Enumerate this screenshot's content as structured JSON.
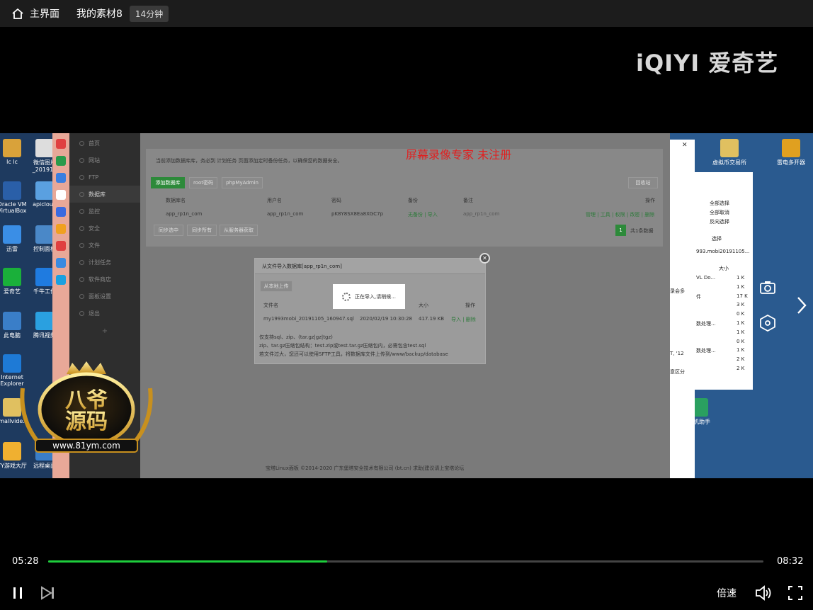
{
  "topbar": {
    "home_label": "主界面",
    "title": "我的素材8",
    "badge": "14分钟"
  },
  "logo": "iQIYI 爱奇艺",
  "watermark": "屏幕录像专家  未注册",
  "desktop_icons": [
    {
      "label": "lc lc",
      "color": "#d9a23a"
    },
    {
      "label": "微信图片_201912",
      "color": "#ddd"
    },
    {
      "label": "Oracle VM VirtualBox",
      "color": "#2a5fa8"
    },
    {
      "label": "apicloud",
      "color": "#5aa0e0"
    },
    {
      "label": "迅雷",
      "color": "#3a8ee6"
    },
    {
      "label": "控制面板",
      "color": "#4a88c8"
    },
    {
      "label": "爱奇艺",
      "color": "#1ab03a"
    },
    {
      "label": "千牛工作",
      "color": "#1f7be0"
    },
    {
      "label": "此电脑",
      "color": "#3a7ec8"
    },
    {
      "label": "腾讯视频",
      "color": "#2aa0e0"
    },
    {
      "label": "Internet Explorer",
      "color": "#1e7ad6"
    },
    {
      "label": "smallvide...",
      "color": "#e0c060"
    },
    {
      "label": "YY游戏大厅",
      "color": "#f0b030"
    },
    {
      "label": "远程桌面",
      "color": "#3a7ec8"
    },
    {
      "label": "虚拟币交易所",
      "color": "#e0c060"
    },
    {
      "label": "雷电多开器",
      "color": "#e0a020"
    },
    {
      "label": "手机助手",
      "color": "#2aa060"
    }
  ],
  "sidebar_items": [
    {
      "label": "首页"
    },
    {
      "label": "网站"
    },
    {
      "label": "FTP"
    },
    {
      "label": "数据库"
    },
    {
      "label": "监控"
    },
    {
      "label": "安全"
    },
    {
      "label": "文件"
    },
    {
      "label": "计划任务"
    },
    {
      "label": "软件商店"
    },
    {
      "label": "面板设置"
    },
    {
      "label": "退出"
    }
  ],
  "notice": "当前添加数据库库，务必到 计划任务 页面添加定时备份任务，以确保您的数据安全。",
  "toolbar": {
    "add_db": "添加数据库",
    "root_pwd": "root密码",
    "phpmyadmin": "phpMyAdmin",
    "recycle": "回收站"
  },
  "table": {
    "headers": [
      "数据库名",
      "用户名",
      "密码",
      "备份",
      "备注",
      "操作"
    ],
    "row": {
      "name": "app_rp1n_com",
      "user": "app_rp1n_com",
      "password": "pK8Y8SX8Ea8XGC7p",
      "backup": "无备份 | 导入",
      "remark": "app_rp1n_com",
      "ops": "管理 | 工具 | 权限 | 改密 | 删除"
    }
  },
  "bottom_btns": {
    "sync_selected": "同步选中",
    "sync_all": "同步所有",
    "from_server": "从服务器获取"
  },
  "pager": {
    "page": "1",
    "total": "共1条数据"
  },
  "modal": {
    "title": "从文件导入数据库[app_rp1n_com]",
    "upload_btn": "从本地上传",
    "headers": [
      "文件名",
      "大小",
      "操作"
    ],
    "file": {
      "name": "my1993mobi_20191105_160947.sql",
      "date": "2020/02/19 10:30:28",
      "size": "417.19 KB",
      "ops": "导入 | 删除"
    },
    "notes": [
      "仅支持sql、zip、(tar.gz|gz|tgz)",
      "zip、tar.gz压缩包结构：test.zip或test.tar.gz压缩包内，必需包含test.sql",
      "若文件过大，您还可以使用SFTP工具，将数据库文件上传到/www/backup/database"
    ]
  },
  "loading_text": "正在导入,请稍候...",
  "footer": "宝塔Linux面板 ©2014-2020 广东堡塔安全技术有限公司 (bt.cn)   求助|建议请上宝塔论坛",
  "explorer": {
    "menu": [
      "全部选择",
      "全部取消",
      "反向选择"
    ],
    "section": "选择",
    "path": "993.mobi20191105...",
    "size_header": "大小",
    "items": [
      {
        "name": "VL Do...",
        "size": "1 K"
      },
      {
        "name": "",
        "size": "1 K"
      },
      {
        "name": "件",
        "size": "17 K"
      },
      {
        "name": "",
        "size": "3 K"
      },
      {
        "name": "",
        "size": "0 K"
      },
      {
        "name": "数处理...",
        "size": "1 K"
      },
      {
        "name": "",
        "size": "1 K"
      },
      {
        "name": "",
        "size": "0 K"
      },
      {
        "name": "数处理...",
        "size": "1 K"
      },
      {
        "name": "",
        "size": "2 K"
      },
      {
        "name": "",
        "size": "2 K"
      }
    ],
    "side_texts": [
      "录会多",
      "T, '12",
      "意区分"
    ]
  },
  "emblem": {
    "top": "八爷",
    "bottom": "源码",
    "url": "www.81ym.com"
  },
  "player": {
    "current": "05:28",
    "total": "08:32",
    "progress": 0.39,
    "speed_label": "倍速"
  }
}
